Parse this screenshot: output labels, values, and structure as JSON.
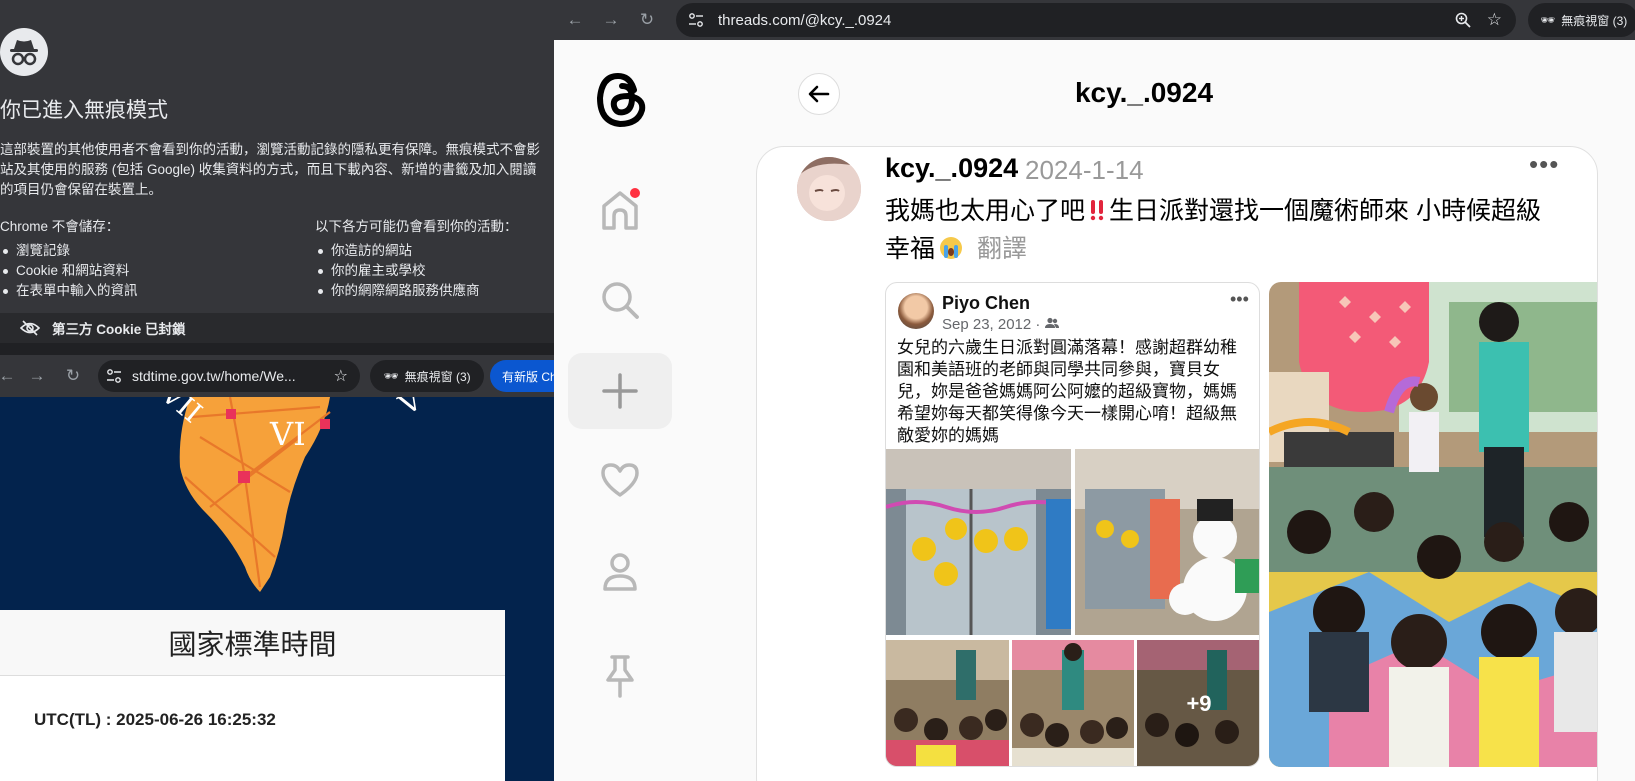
{
  "incognito": {
    "title": "你已進入無痕模式",
    "description": [
      "這部裝置的其他使用者不會看到你的活動，瀏覽活動記錄的隱私更有保障。無痕模式不會影",
      "站及其使用的服務 (包括 Google) 收集資料的方式，而且下載內容、新增的書籤及加入閱讀",
      "的項目仍會保留在裝置上。"
    ],
    "col1": {
      "heading": "Chrome 不會儲存：",
      "items": [
        "瀏覽記錄",
        "Cookie 和網站資料",
        "在表單中輸入的資訊"
      ]
    },
    "col2": {
      "heading": "以下各方可能仍會看到你的活動：",
      "items": [
        "你造訪的網站",
        "你的雇主或學校",
        "你的網際網路服務供應商"
      ]
    },
    "cookie_notice": "第三方 Cookie 已封鎖"
  },
  "left_browser": {
    "url": "stdtime.gov.tw/home/We...",
    "incognito_chip": "無痕視窗 (3)",
    "update_chip": "有新版 Ch"
  },
  "timesite": {
    "title": "國家標準時間",
    "utc": "UTC(TL) : 2025-06-26 16:25:32",
    "clock_numerals": [
      "VII",
      "VI",
      "V"
    ]
  },
  "right_browser": {
    "url": "threads.com/@kcy._.0924",
    "incognito_chip": "無痕視窗 (3)"
  },
  "threads": {
    "header_title": "kcy._.0924",
    "post": {
      "username": "kcy._.0924",
      "date": "2024-1-14",
      "more": "•••",
      "text_part1": "我媽也太用心了吧",
      "text_part2": "生日派對還找一個魔術師來 小時候超級幸福",
      "translate": "翻譯"
    },
    "embed": {
      "name": "Piyo Chen",
      "date": "Sep 23, 2012 ·",
      "more": "•••",
      "text": "女兒的六歲生日派對圓滿落幕！感謝超群幼稚園和美語班的老師與同學共同參與，寶貝女兒，妳是爸爸媽媽阿公阿嬤的超級寶物，媽媽希望妳每天都笑得像今天一樣開心唷！超級無敵愛妳的媽媽",
      "more_photos": "+9"
    },
    "colors": {
      "notification": "#ff3040",
      "bg": "#fafafa"
    }
  }
}
